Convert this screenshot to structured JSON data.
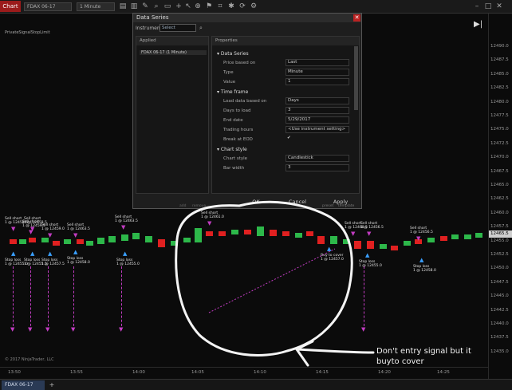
{
  "toolbar": {
    "chart_tab": "Chart",
    "instrument": "FDAX 06-17",
    "interval": "1 Minute"
  },
  "chart": {
    "strategy_label": "PrivateSignalStopLimit",
    "copyright": "© 2017 NinjaTrader, LLC",
    "price_labels": [
      "12490.0",
      "12487.5",
      "12485.0",
      "12482.5",
      "12480.0",
      "12477.5",
      "12475.0",
      "12472.5",
      "12470.0",
      "12467.5",
      "12465.0",
      "12462.5",
      "12460.0",
      "12457.5",
      "12455.0",
      "12452.5",
      "12450.0",
      "12447.5",
      "12445.0",
      "12442.5",
      "12440.0",
      "12437.5",
      "12435.0"
    ],
    "current_price": "12465.5",
    "time_labels": [
      "13:50",
      "13:55",
      "14:00",
      "14:05",
      "14:10",
      "14:15",
      "14:20",
      "14:25"
    ]
  },
  "signals": [
    {
      "text": "Sell short\n1 @ 12458.5"
    },
    {
      "text": "Sell short\n1 @ 12459.5"
    },
    {
      "text": "Sell short\n1 @ 12459.0"
    },
    {
      "text": "Sell short\n1 @ 12463.5"
    },
    {
      "text": "Sell short\n1 @ 12463.5"
    },
    {
      "text": "Sell short\n1 @ 12461.0"
    },
    {
      "text": "Sell short\n1 @ 12468.5"
    },
    {
      "text": "Sell short\n1 @ 12456.5"
    },
    {
      "text": "Sell short\n1 @ 12456.5"
    },
    {
      "text": "Stop loss\n1 @ 12455.0"
    },
    {
      "text": "Stop loss\n1 @ 12455.5"
    },
    {
      "text": "Stop loss\n1 @ 12457.5"
    },
    {
      "text": "Stop loss\n1 @ 12458.0"
    },
    {
      "text": "Stop loss\n1 @ 12455.0"
    },
    {
      "text": "Buy to cover\n1 @ 12457.0"
    },
    {
      "text": "Stop loss\n1 @ 12455.0"
    },
    {
      "text": "Stop loss\n1 @ 12458.0"
    },
    {
      "text": "Sell short\n1 @ 12458.5"
    }
  ],
  "dialog": {
    "title": "Data Series",
    "instrument_label": "Instrument",
    "instrument_value": "Select",
    "applied_header": "Applied",
    "applied_item": "FDAX 06-17 (1 Minute)",
    "applied_footer_add": "add",
    "applied_footer_remove": "remove",
    "properties_header": "Properties",
    "sections": {
      "data_series": "Data Series",
      "time_frame": "Time frame",
      "chart_style": "Chart style"
    },
    "props": [
      {
        "name": "Price based on",
        "value": "Last"
      },
      {
        "name": "Type",
        "value": "Minute"
      },
      {
        "name": "Value",
        "value": "1"
      },
      {
        "name": "Load data based on",
        "value": "Days"
      },
      {
        "name": "Days to load",
        "value": "3"
      },
      {
        "name": "End date",
        "value": "5/29/2017"
      },
      {
        "name": "Trading hours",
        "value": "<Use instrument setting>"
      },
      {
        "name": "Break at EOD",
        "value": "✔"
      },
      {
        "name": "Chart style",
        "value": "Candlestick"
      },
      {
        "name": "Bar width",
        "value": "3"
      }
    ],
    "preset_label": "preset",
    "preset_value": "template",
    "buttons": {
      "ok": "OK",
      "cancel": "Cancel",
      "apply": "Apply"
    }
  },
  "annotation": {
    "text": "Don't entry signal but it buyto cover"
  },
  "bottom_tabs": {
    "tab": "FDAX 06-17",
    "add": "+"
  },
  "colors": {
    "up": "#2db84a",
    "down": "#e02020",
    "signal": "#c23cc2",
    "stop": "#3aa0ff"
  }
}
